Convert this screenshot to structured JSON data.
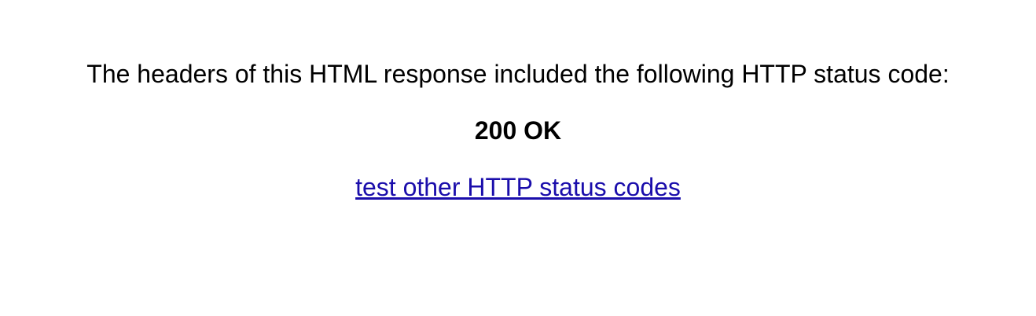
{
  "intro_text": "The headers of this HTML response included the following HTTP status code:",
  "status_code": "200 OK",
  "link": {
    "label": "test other HTTP status codes",
    "color": "#1a0dab"
  }
}
